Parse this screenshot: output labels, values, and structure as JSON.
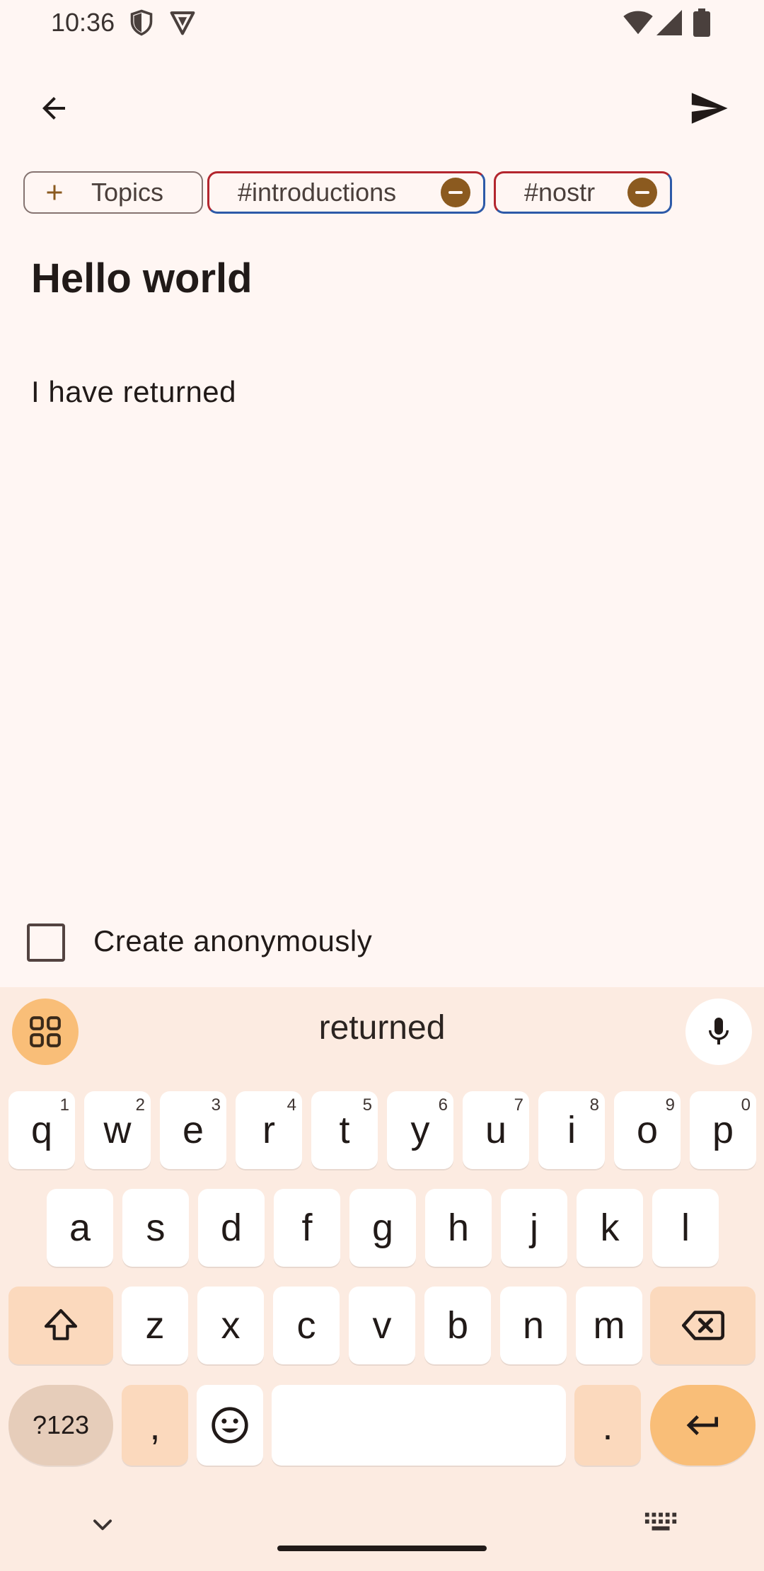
{
  "status_bar": {
    "time": "10:36"
  },
  "compose": {
    "back_icon": "arrow-back-icon",
    "send_icon": "send-icon",
    "topics_chip": "Topics",
    "tags": [
      {
        "label": "#introductions"
      },
      {
        "label": "#nostr"
      }
    ],
    "title": "Hello world",
    "body": "I have returned",
    "anonymous_label": "Create anonymously",
    "anonymous_checked": false
  },
  "keyboard": {
    "suggestion": "returned",
    "row1": [
      {
        "k": "q",
        "h": "1"
      },
      {
        "k": "w",
        "h": "2"
      },
      {
        "k": "e",
        "h": "3"
      },
      {
        "k": "r",
        "h": "4"
      },
      {
        "k": "t",
        "h": "5"
      },
      {
        "k": "y",
        "h": "6"
      },
      {
        "k": "u",
        "h": "7"
      },
      {
        "k": "i",
        "h": "8"
      },
      {
        "k": "o",
        "h": "9"
      },
      {
        "k": "p",
        "h": "0"
      }
    ],
    "row2": [
      "a",
      "s",
      "d",
      "f",
      "g",
      "h",
      "j",
      "k",
      "l"
    ],
    "row3": [
      "z",
      "x",
      "c",
      "v",
      "b",
      "n",
      "m"
    ],
    "symbols_label": "?123",
    "comma": ",",
    "period": ".",
    "colors": {
      "accent": "#F9BE78",
      "mod_key": "#FBD9BD",
      "background": "#FCEBE1"
    }
  }
}
